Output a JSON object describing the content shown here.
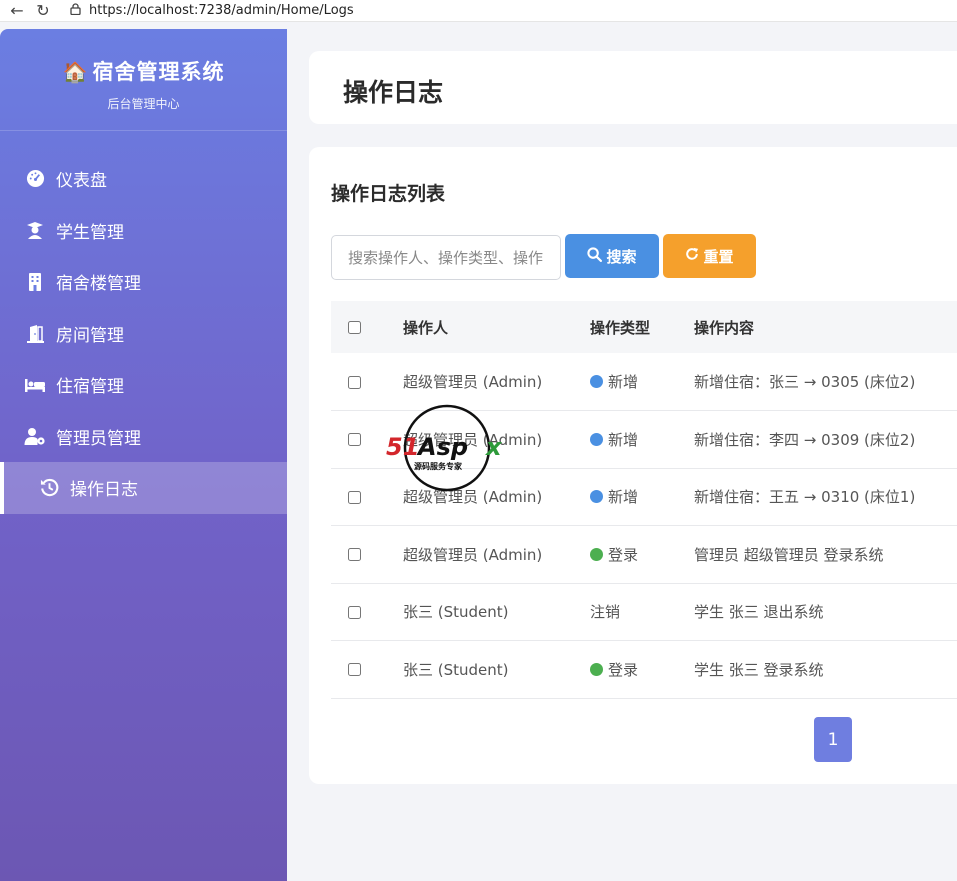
{
  "browser": {
    "url": "https://localhost:7238/admin/Home/Logs"
  },
  "brand": {
    "title": "宿舍管理系统",
    "subtitle": "后台管理中心"
  },
  "menu": [
    {
      "label": "仪表盘",
      "icon": "dashboard-icon"
    },
    {
      "label": "学生管理",
      "icon": "graduate-icon"
    },
    {
      "label": "宿舍楼管理",
      "icon": "building-icon"
    },
    {
      "label": "房间管理",
      "icon": "door-icon"
    },
    {
      "label": "住宿管理",
      "icon": "bed-icon"
    },
    {
      "label": "管理员管理",
      "icon": "user-gear-icon"
    },
    {
      "label": "操作日志",
      "icon": "history-icon",
      "active": true
    }
  ],
  "page": {
    "title": "操作日志",
    "list_title": "操作日志列表"
  },
  "search": {
    "placeholder": "搜索操作人、操作类型、操作内容",
    "search_label": "搜索",
    "reset_label": "重置"
  },
  "table": {
    "headers": [
      "操作人",
      "操作类型",
      "操作内容"
    ],
    "rows": [
      {
        "user": "超级管理员 (Admin)",
        "type": "新增",
        "dot": "blue",
        "content": "新增住宿：张三 → 0305 (床位2)"
      },
      {
        "user": "超级管理员 (Admin)",
        "type": "新增",
        "dot": "blue",
        "content": "新增住宿：李四 → 0309 (床位2)"
      },
      {
        "user": "超级管理员 (Admin)",
        "type": "新增",
        "dot": "blue",
        "content": "新增住宿：王五 → 0310 (床位1)"
      },
      {
        "user": "超级管理员 (Admin)",
        "type": "登录",
        "dot": "green",
        "content": "管理员 超级管理员 登录系统"
      },
      {
        "user": "张三 (Student)",
        "type": "注销",
        "dot": "",
        "content": "学生 张三 退出系统"
      },
      {
        "user": "张三 (Student)",
        "type": "登录",
        "dot": "green",
        "content": "学生 张三 登录系统"
      }
    ]
  },
  "pagination": {
    "current": "1"
  },
  "watermark": {
    "brand": "51Aspx",
    "tagline": "源码服务专家"
  },
  "colors": {
    "sidebar_top": "#6b7ee2",
    "sidebar_bottom": "#6c57b3",
    "search_button": "#4a90e2",
    "reset_button": "#f5a02c",
    "pager": "#6f7ee0",
    "dot_blue": "#4a90e2",
    "dot_green": "#4caf50"
  }
}
